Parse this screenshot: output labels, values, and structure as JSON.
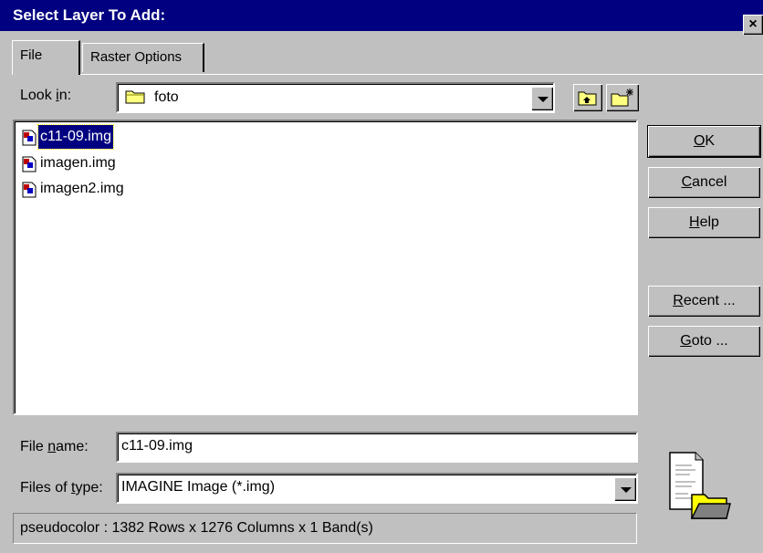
{
  "window": {
    "title": "Select Layer To Add:",
    "close_label": "×"
  },
  "tabs": [
    {
      "label": "File",
      "active": true
    },
    {
      "label": "Raster Options",
      "active": false
    }
  ],
  "look_in": {
    "label_pre": "Look ",
    "label_key": "i",
    "label_post": "n:",
    "value": "foto"
  },
  "files": [
    {
      "name": "c11-09.img",
      "selected": true
    },
    {
      "name": "imagen.img",
      "selected": false
    },
    {
      "name": "imagen2.img",
      "selected": false
    }
  ],
  "buttons": {
    "ok": {
      "key": "O",
      "rest": "K"
    },
    "cancel": {
      "key": "C",
      "rest": "ancel"
    },
    "help": {
      "key": "H",
      "rest": "elp"
    },
    "recent": {
      "key": "R",
      "rest": "ecent ..."
    },
    "goto": {
      "key": "G",
      "rest": "oto ..."
    }
  },
  "file_name": {
    "label_pre": "File ",
    "label_key": "n",
    "label_post": "ame:",
    "value": "c11-09.img"
  },
  "file_type": {
    "label_pre": "Files of ",
    "label_key": "t",
    "label_post": "ype:",
    "value": "IMAGINE Image (*.img)"
  },
  "status_text": "pseudocolor : 1382 Rows x 1276 Columns x 1 Band(s)",
  "icons": [
    "folder-icon",
    "up-one-level-icon",
    "new-folder-icon",
    "image-file-icon",
    "document-folder-icon"
  ],
  "colors": {
    "titlebar": "#000080",
    "face": "#c0c0c0",
    "selection": "#000080"
  }
}
